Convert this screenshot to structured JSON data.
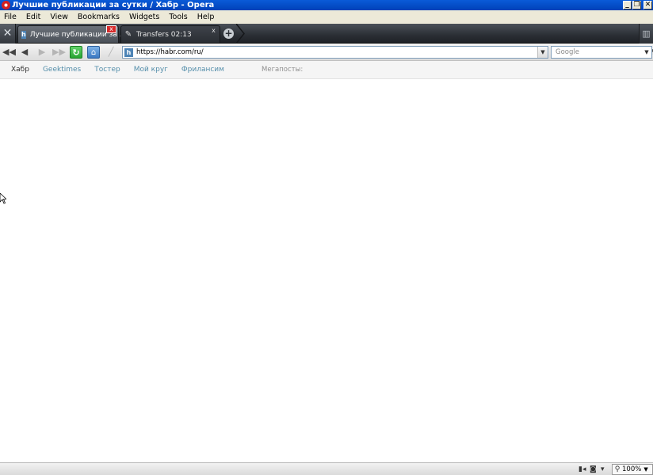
{
  "window": {
    "title": "Лучшие публикации за сутки / Хабр - Opera",
    "buttons": {
      "minimize": "_",
      "maximize": "❐",
      "close": "✕"
    }
  },
  "menu": {
    "items": [
      {
        "label": "File"
      },
      {
        "label": "Edit"
      },
      {
        "label": "View"
      },
      {
        "label": "Bookmarks"
      },
      {
        "label": "Widgets"
      },
      {
        "label": "Tools"
      },
      {
        "label": "Help"
      }
    ]
  },
  "tabs": {
    "items": [
      {
        "label": "Лучшие публикации за ...",
        "favicon": "h",
        "close": "x",
        "active": true
      },
      {
        "label": "Transfers 02:13",
        "favicon": "transfer-icon",
        "close": "x",
        "active": false
      }
    ],
    "new_tab": "+"
  },
  "toolbar": {
    "address": {
      "value": "https://habr.com/ru/",
      "favicon": "h"
    },
    "search": {
      "placeholder": "Google"
    }
  },
  "site_nav": {
    "items": [
      {
        "label": "Хабр",
        "current": true
      },
      {
        "label": "Geektimes"
      },
      {
        "label": "Тостер"
      },
      {
        "label": "Мой круг"
      },
      {
        "label": "Фрилансим"
      }
    ],
    "megaposts_label": "Мегапосты:"
  },
  "status": {
    "zoom": "100%"
  },
  "colors": {
    "titlebar": "#0a5bd8",
    "site_link": "#548eaa",
    "tab_close_active": "#d62a2a"
  }
}
